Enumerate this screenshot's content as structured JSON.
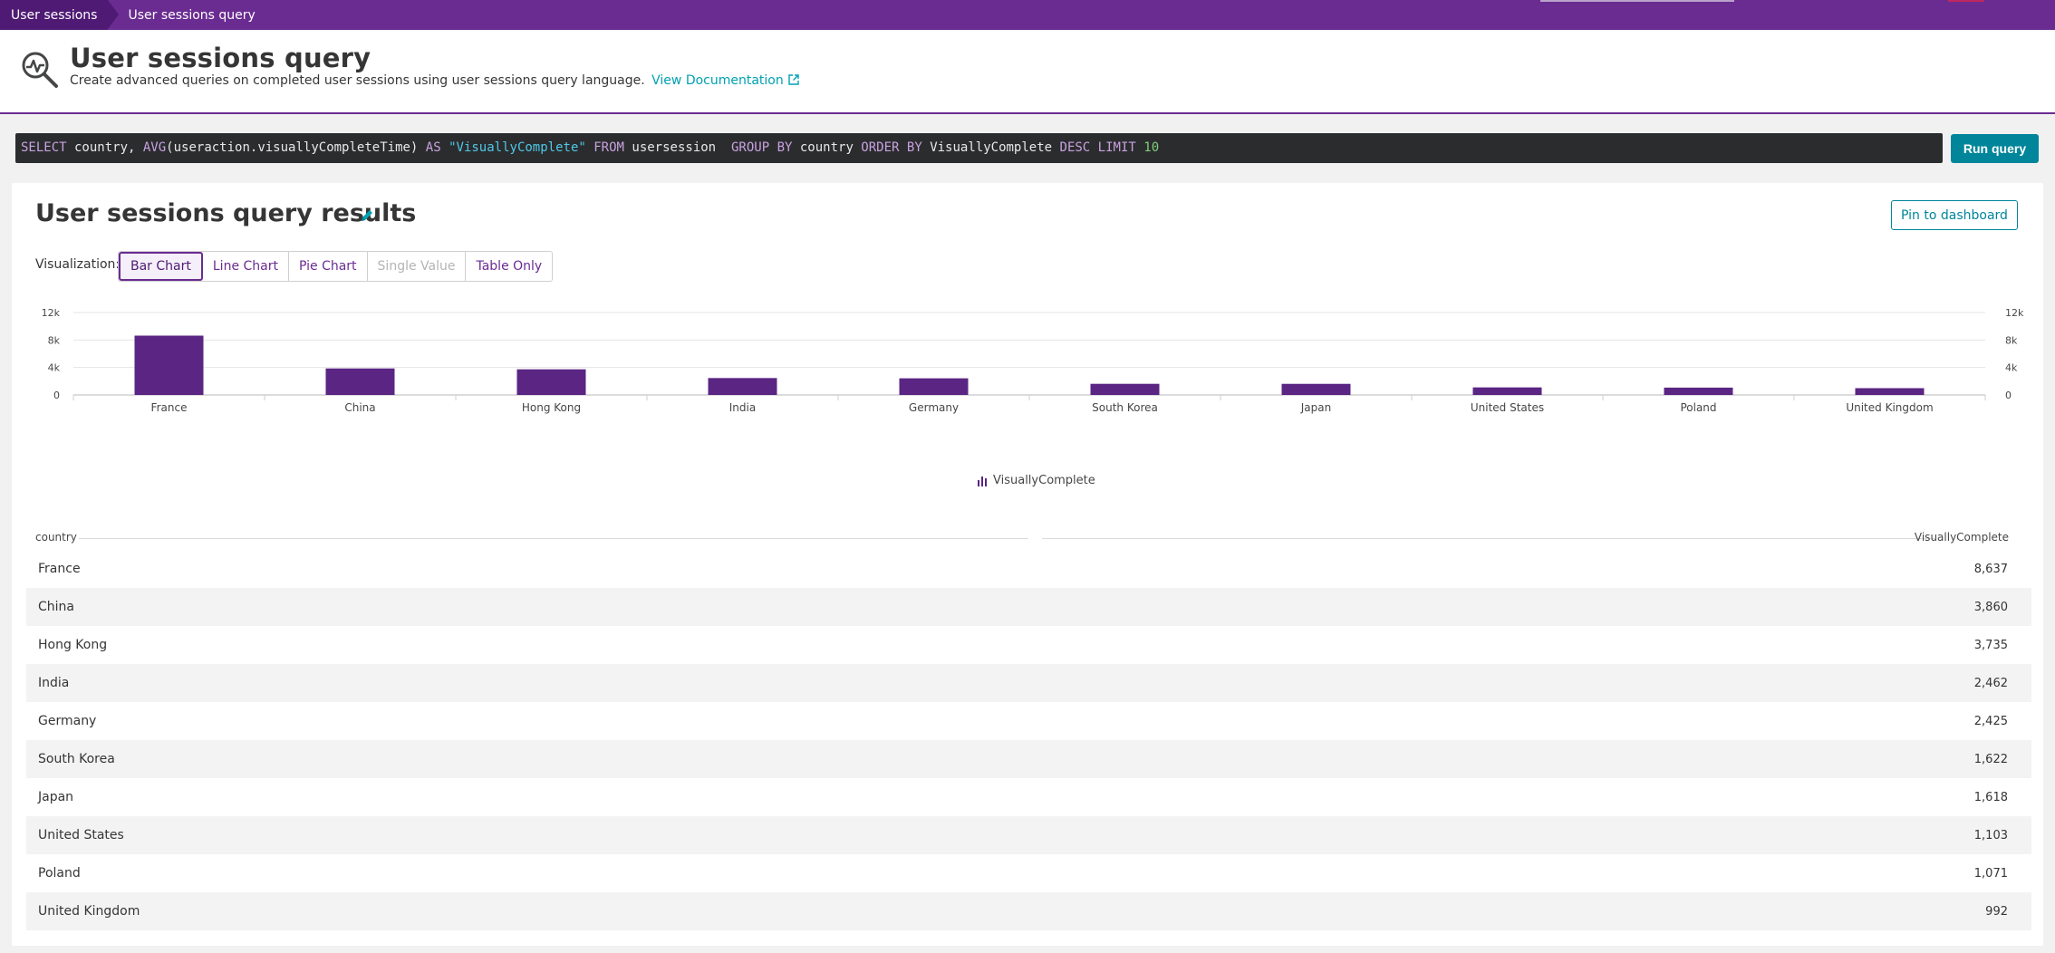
{
  "breadcrumb": {
    "items": [
      "User sessions",
      "User sessions query"
    ]
  },
  "header": {
    "title": "User sessions query",
    "subtitle": "Create advanced queries on completed user sessions using user sessions query language.",
    "doc_link": "View Documentation",
    "icon": "query-magnifier-icon"
  },
  "query": {
    "text": "SELECT country, AVG(useraction.visuallyCompleteTime) AS \"VisuallyComplete\" FROM usersession  GROUP BY country ORDER BY VisuallyComplete DESC LIMIT 10",
    "run_label": "Run query"
  },
  "results": {
    "title": "User sessions query results",
    "pin_label": "Pin to dashboard",
    "visualization_label": "Visualization:",
    "visualizations": [
      {
        "label": "Bar Chart",
        "state": "active"
      },
      {
        "label": "Line Chart",
        "state": "enabled"
      },
      {
        "label": "Pie Chart",
        "state": "enabled"
      },
      {
        "label": "Single Value",
        "state": "disabled"
      },
      {
        "label": "Table Only",
        "state": "enabled"
      }
    ]
  },
  "chart_data": {
    "type": "bar",
    "categories": [
      "France",
      "China",
      "Hong Kong",
      "India",
      "Germany",
      "South Korea",
      "Japan",
      "United States",
      "Poland",
      "United Kingdom"
    ],
    "series": [
      {
        "name": "VisuallyComplete",
        "values": [
          8637,
          3860,
          3735,
          2462,
          2425,
          1622,
          1618,
          1103,
          1071,
          992
        ],
        "color": "#5b2583"
      }
    ],
    "yticks": [
      "0",
      "4k",
      "8k",
      "12k"
    ],
    "ylim": [
      0,
      12000
    ],
    "grid": true,
    "legend": "bottom-center"
  },
  "table": {
    "columns": [
      "country",
      "VisuallyComplete"
    ],
    "rows": [
      [
        "France",
        "8,637"
      ],
      [
        "China",
        "3,860"
      ],
      [
        "Hong Kong",
        "3,735"
      ],
      [
        "India",
        "2,462"
      ],
      [
        "Germany",
        "2,425"
      ],
      [
        "South Korea",
        "1,622"
      ],
      [
        "Japan",
        "1,618"
      ],
      [
        "United States",
        "1,103"
      ],
      [
        "Poland",
        "1,071"
      ],
      [
        "United Kingdom",
        "992"
      ]
    ]
  },
  "colors": {
    "brand": "#6a2c91",
    "accent": "#00859a",
    "link": "#00a1b2",
    "bar": "#5b2583"
  }
}
